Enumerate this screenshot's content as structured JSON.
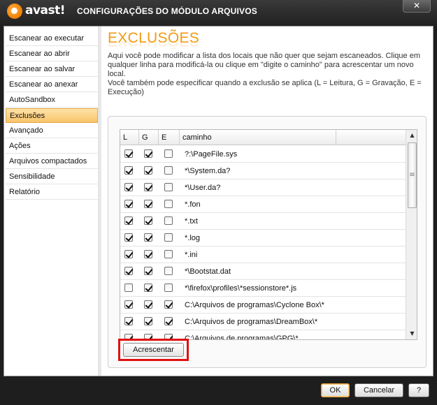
{
  "window": {
    "brand": "avast!",
    "title": "CONFIGURAÇÕES DO MÓDULO ARQUIVOS",
    "close_glyph": "✕"
  },
  "sidebar": {
    "items": [
      {
        "label": "Escanear ao executar",
        "active": false
      },
      {
        "label": "Escanear ao abrir",
        "active": false
      },
      {
        "label": "Escanear ao salvar",
        "active": false
      },
      {
        "label": "Escanear ao anexar",
        "active": false
      },
      {
        "label": "AutoSandbox",
        "active": false
      },
      {
        "label": "Exclusões",
        "active": true
      },
      {
        "label": "Avançado",
        "active": false
      },
      {
        "label": "Ações",
        "active": false
      },
      {
        "label": "Arquivos compactados",
        "active": false
      },
      {
        "label": "Sensibilidade",
        "active": false
      },
      {
        "label": "Relatório",
        "active": false
      }
    ]
  },
  "main": {
    "heading": "EXCLUSÕES",
    "description_1": "Aqui você pode modificar a lista dos locais que não quer que sejam escaneados. Clique em qualquer linha para modificá-la ou clique em \"digite o caminho\" para acrescentar um novo local.",
    "description_2": "Você também pode especificar quando a exclusão se aplica (L = Leitura, G = Gravação, E = Execução)"
  },
  "table": {
    "headers": {
      "l": "L",
      "g": "G",
      "e": "E",
      "path": "caminho"
    },
    "rows": [
      {
        "l": true,
        "g": true,
        "e": false,
        "path": "?:\\PageFile.sys"
      },
      {
        "l": true,
        "g": true,
        "e": false,
        "path": "*\\System.da?"
      },
      {
        "l": true,
        "g": true,
        "e": false,
        "path": "*\\User.da?"
      },
      {
        "l": true,
        "g": true,
        "e": false,
        "path": "*.fon"
      },
      {
        "l": true,
        "g": true,
        "e": false,
        "path": "*.txt"
      },
      {
        "l": true,
        "g": true,
        "e": false,
        "path": "*.log"
      },
      {
        "l": true,
        "g": true,
        "e": false,
        "path": "*.ini"
      },
      {
        "l": true,
        "g": true,
        "e": false,
        "path": "*\\Bootstat.dat"
      },
      {
        "l": false,
        "g": true,
        "e": false,
        "path": "*\\firefox\\profiles\\*sessionstore*.js"
      },
      {
        "l": true,
        "g": true,
        "e": true,
        "path": "C:\\Arquivos de programas\\Cyclone Box\\*"
      },
      {
        "l": true,
        "g": true,
        "e": true,
        "path": "C:\\Arquivos de programas\\DreamBox\\*"
      },
      {
        "l": true,
        "g": true,
        "e": true,
        "path": "C:\\Arquivos de programas\\GPG\\*"
      }
    ],
    "scroll_up_glyph": "▲",
    "scroll_down_glyph": "▼",
    "scroll_grip_glyph": "≡"
  },
  "buttons": {
    "add": "Acrescentar",
    "ok": "OK",
    "cancel": "Cancelar",
    "help": "?"
  },
  "colors": {
    "accent": "#f39a10",
    "highlight_box": "#e01010",
    "active_nav": "#f8c46a"
  }
}
